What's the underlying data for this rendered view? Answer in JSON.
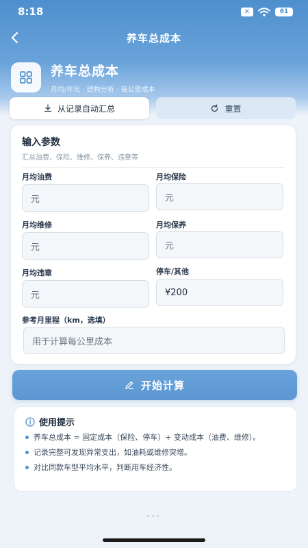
{
  "status_bar": {
    "time": "8:18",
    "battery": "61"
  },
  "nav": {
    "title": "养车总成本"
  },
  "hero": {
    "title": "养车总成本",
    "subtitle": "月均/年化 · 结构分析 · 每公里成本"
  },
  "tabs": [
    {
      "label": "从记录自动汇总",
      "icon": "download-icon"
    },
    {
      "label": "重置",
      "icon": "refresh-icon"
    }
  ],
  "form": {
    "title": "输入参数",
    "subtitle": "汇总油费、保险、维修、保养、违章等",
    "fields": [
      {
        "label": "月均油费",
        "placeholder": "元",
        "value": ""
      },
      {
        "label": "月均保险",
        "placeholder": "元",
        "value": ""
      },
      {
        "label": "月均维修",
        "placeholder": "元",
        "value": ""
      },
      {
        "label": "月均保养",
        "placeholder": "元",
        "value": ""
      },
      {
        "label": "月均违章",
        "placeholder": "元",
        "value": ""
      },
      {
        "label": "停车/其他",
        "placeholder": "",
        "value": "¥200"
      }
    ],
    "mileage": {
      "label": "参考月里程（km，选填）",
      "placeholder": "用于计算每公里成本"
    }
  },
  "calc_button": {
    "label": "开始计算",
    "icon": "edit-icon"
  },
  "tips": {
    "title": "使用提示",
    "items": [
      "养车总成本 = 固定成本（保险、停车）+ 变动成本（油费、维修）。",
      "记录完整可发现异常支出，如油耗或维修突增。",
      "对比同款车型平均水平，判断用车经济性。"
    ]
  },
  "colors": {
    "accent": "#4e8fce",
    "background": "#eef3f9"
  }
}
